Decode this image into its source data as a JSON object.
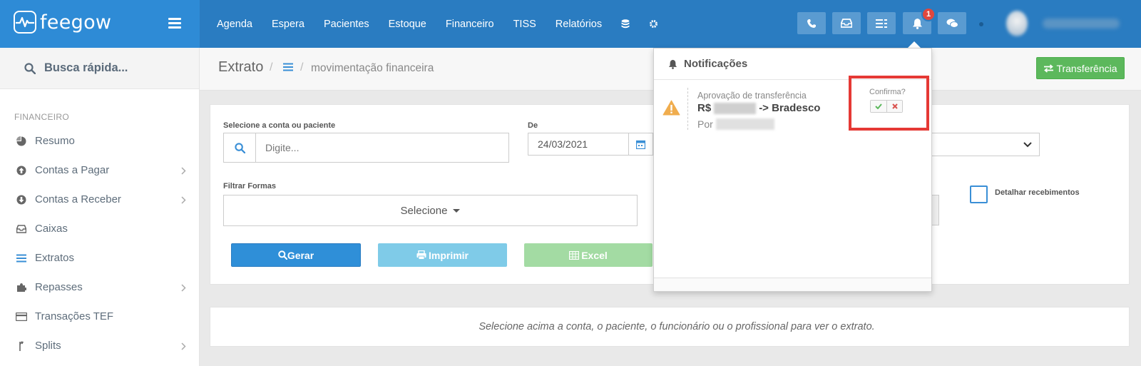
{
  "brand": {
    "name": "feegow"
  },
  "nav": {
    "items": [
      "Agenda",
      "Espera",
      "Pacientes",
      "Estoque",
      "Financeiro",
      "TISS",
      "Relatórios"
    ],
    "icons": [
      "database-icon",
      "gear-icon"
    ]
  },
  "toolbar": {
    "buttons": [
      "phone-icon",
      "inbox-icon",
      "list-icon",
      "bell-icon",
      "chat-icon"
    ],
    "notification_count": "1"
  },
  "sidebar": {
    "search_label": "Busca rápida...",
    "section": "FINANCEIRO",
    "items": [
      {
        "label": "Resumo",
        "icon": "pie-chart-icon",
        "has_children": false
      },
      {
        "label": "Contas a Pagar",
        "icon": "arrow-up-circle-icon",
        "has_children": true
      },
      {
        "label": "Contas a Receber",
        "icon": "arrow-down-circle-icon",
        "has_children": true
      },
      {
        "label": "Caixas",
        "icon": "inbox-icon",
        "has_children": false
      },
      {
        "label": "Extratos",
        "icon": "list-icon",
        "has_children": false
      },
      {
        "label": "Repasses",
        "icon": "puzzle-icon",
        "has_children": true
      },
      {
        "label": "Transações TEF",
        "icon": "credit-card-icon",
        "has_children": false
      },
      {
        "label": "Splits",
        "icon": "split-icon",
        "has_children": true
      }
    ]
  },
  "page": {
    "title": "Extrato",
    "subtitle": "movimentação financeira",
    "transfer_button": "Transferência"
  },
  "filters": {
    "account_label": "Selecione a conta ou paciente",
    "account_placeholder": "Digite...",
    "date_label": "De",
    "date_value": "24/03/2021",
    "forms_label": "Filtrar Formas",
    "forms_select": "Selecione",
    "detail_label": "Detalhar recebimentos",
    "detail_checked": false
  },
  "actions": {
    "generate": "Gerar",
    "print": "Imprimir",
    "excel": "Excel"
  },
  "empty_message": "Selecione acima a conta, o paciente, o funcionário ou o profissional para ver o extrato.",
  "notifications": {
    "title": "Notificações",
    "items": [
      {
        "title": "Aprovação de transferência",
        "amount_prefix": "R$",
        "amount_suffix": "-> Bradesco",
        "by_prefix": "Por",
        "confirm_label": "Confirma?"
      }
    ]
  },
  "colors": {
    "topbar": "#2a7cc1",
    "brand": "#2e8bd6",
    "primary": "#2f8fd8",
    "info": "#7fcbe8",
    "success": "#5cb85c",
    "danger": "#e53935"
  }
}
